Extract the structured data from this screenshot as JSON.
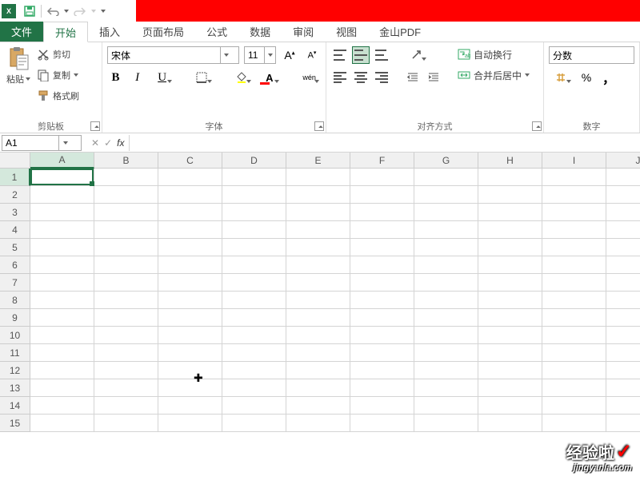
{
  "qat": {
    "app_icon": "X"
  },
  "tabs": {
    "file": "文件",
    "items": [
      "开始",
      "插入",
      "页面布局",
      "公式",
      "数据",
      "审阅",
      "视图",
      "金山PDF"
    ],
    "active_index": 0
  },
  "ribbon": {
    "clipboard": {
      "label": "剪贴板",
      "paste": "粘贴",
      "cut": "剪切",
      "copy": "复制",
      "format_painter": "格式刷"
    },
    "font": {
      "label": "字体",
      "name": "宋体",
      "size": "11",
      "bold": "B",
      "italic": "I",
      "underline": "U",
      "wen": "wén"
    },
    "alignment": {
      "label": "对齐方式",
      "wrap": "自动换行",
      "merge": "合并后居中"
    },
    "number": {
      "label": "数字",
      "format": "分数",
      "percent": "%",
      "comma": "，"
    }
  },
  "namebox": {
    "cell_ref": "A1",
    "cancel": "✕",
    "enter": "✓",
    "fx": "fx"
  },
  "grid": {
    "columns": [
      "A",
      "B",
      "C",
      "D",
      "E",
      "F",
      "G",
      "H",
      "I",
      "J"
    ],
    "rows": [
      "1",
      "2",
      "3",
      "4",
      "5",
      "6",
      "7",
      "8",
      "9",
      "10",
      "11",
      "12",
      "13",
      "14",
      "15"
    ],
    "active": {
      "col": 0,
      "row": 0
    }
  },
  "watermark": {
    "line1": "经验啦",
    "line2": "jingyanla.com"
  }
}
